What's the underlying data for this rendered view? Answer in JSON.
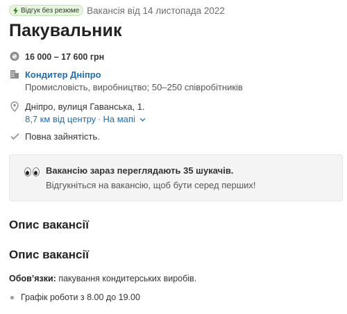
{
  "header": {
    "badge_label": "Відгук без резюме",
    "vacancy_date": "Вакансія від 14 листопада 2022",
    "title": "Пакувальник"
  },
  "details": {
    "salary": "16 000 – 17 600 грн",
    "company": "Кондитер Дніпро",
    "company_info": "Промисловість, виробництво; 50–250 співробітників",
    "address": "Дніпро, вулиця Гаванська, 1.",
    "distance_link": "8,7 км від центру",
    "separator": "·",
    "map_link": "На мапі",
    "employment": "Повна зайнятість."
  },
  "notice": {
    "line1": "Вакансію зараз переглядають 35 шукачів.",
    "line2": "Відгукніться на вакансію, щоб бути серед перших!"
  },
  "description": {
    "section_title": "Опис вакансії",
    "subtitle": "Опис вакансії",
    "duties_label": "Обов’язки:",
    "duties_text": " пакування кондитерських виробів.",
    "bullets": [
      "Графік роботи з 8.00 до 19.00"
    ]
  },
  "colors": {
    "link": "#1d6fb3",
    "badge_bg": "#e6f6df",
    "notice_bg": "#f4f4f4"
  },
  "icons": [
    "lightning-icon",
    "money-icon",
    "building-icon",
    "location-pin-icon",
    "chevron-down-icon",
    "check-icon",
    "eyes-icon"
  ]
}
